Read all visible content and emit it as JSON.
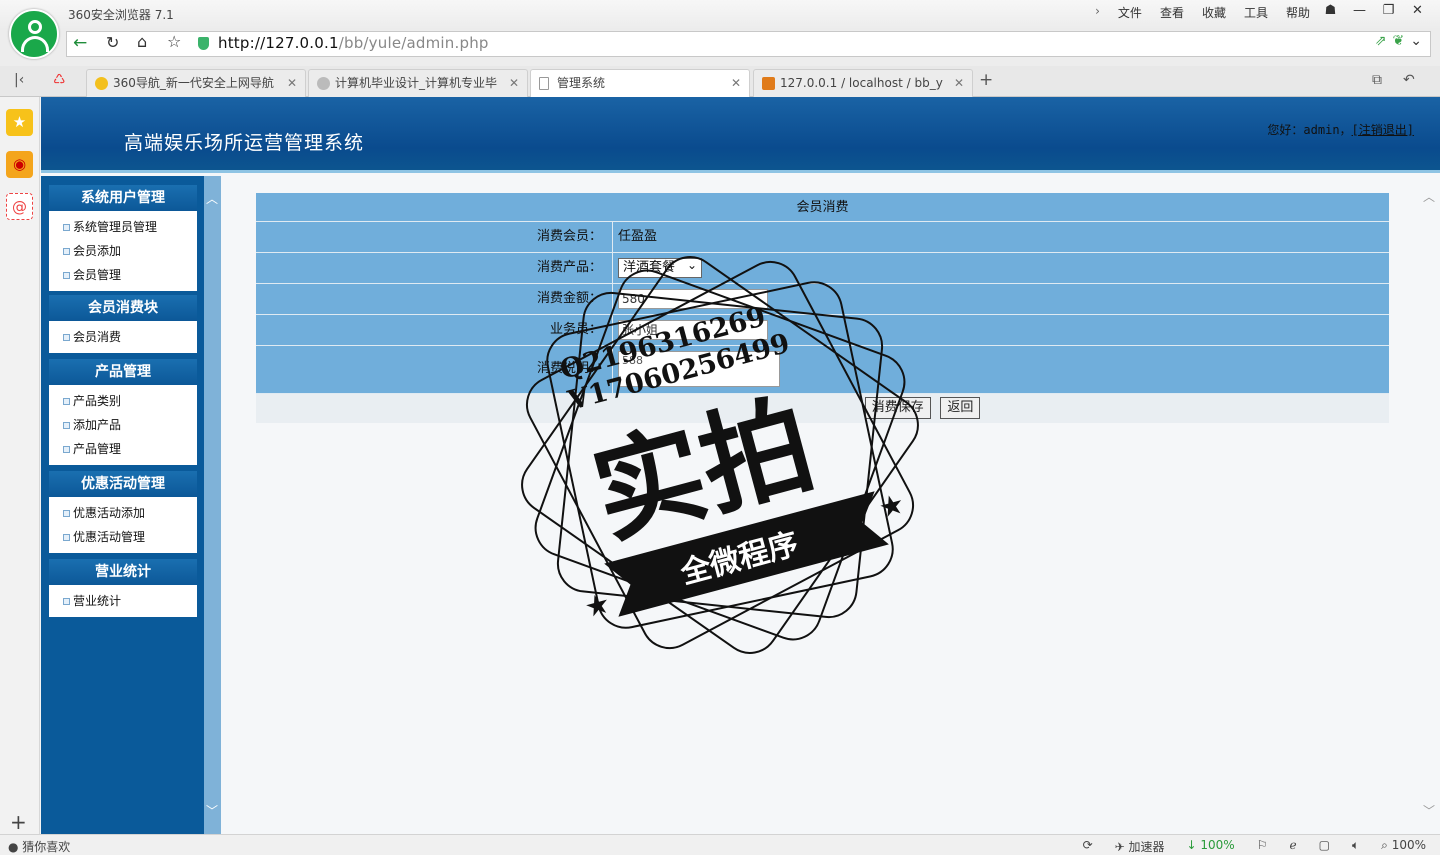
{
  "browser": {
    "app_title": "360安全浏览器 7.1",
    "menus": [
      "文件",
      "查看",
      "收藏",
      "工具",
      "帮助"
    ],
    "url_host": "http://127.0.0.1",
    "url_path": "/bb/yule/admin.php",
    "tabs": [
      {
        "title": "360导航_新一代安全上网导航"
      },
      {
        "title": "计算机毕业设计_计算机专业毕"
      },
      {
        "title": "管理系统"
      },
      {
        "title": "127.0.0.1 / localhost / bb_y"
      }
    ],
    "status_left": "猜你喜欢",
    "status_accelerator": "加速器",
    "status_download": "100%",
    "status_zoom": "100%"
  },
  "header": {
    "system_title": "高端娱乐场所运营管理系统",
    "greeting": "您好：admin，",
    "logout": "[注销退出]"
  },
  "nav": [
    {
      "title": "系统用户管理",
      "items": [
        "系统管理员管理",
        "会员添加",
        "会员管理"
      ]
    },
    {
      "title": "会员消费块",
      "items": [
        "会员消费"
      ]
    },
    {
      "title": "产品管理",
      "items": [
        "产品类别",
        "添加产品",
        "产品管理"
      ]
    },
    {
      "title": "优惠活动管理",
      "items": [
        "优惠活动添加",
        "优惠活动管理"
      ]
    },
    {
      "title": "营业统计",
      "items": [
        "营业统计"
      ]
    }
  ],
  "form": {
    "caption": "会员消费",
    "member_label": "消费会员：",
    "member_value": "任盈盈",
    "product_label": "消费产品：",
    "product_value": "洋酒套餐",
    "amount_label": "消费金额：",
    "amount_value": "580",
    "staff_label": "业务员：",
    "staff_value": "张小姐",
    "note_label": "消费说明：",
    "note_value": "588",
    "save_button": "消费保存",
    "back_button": "返回"
  },
  "watermark": {
    "line1": "Q2196316269",
    "line2": "V17060256499",
    "big": "实拍",
    "ribbon": "全微程序"
  }
}
